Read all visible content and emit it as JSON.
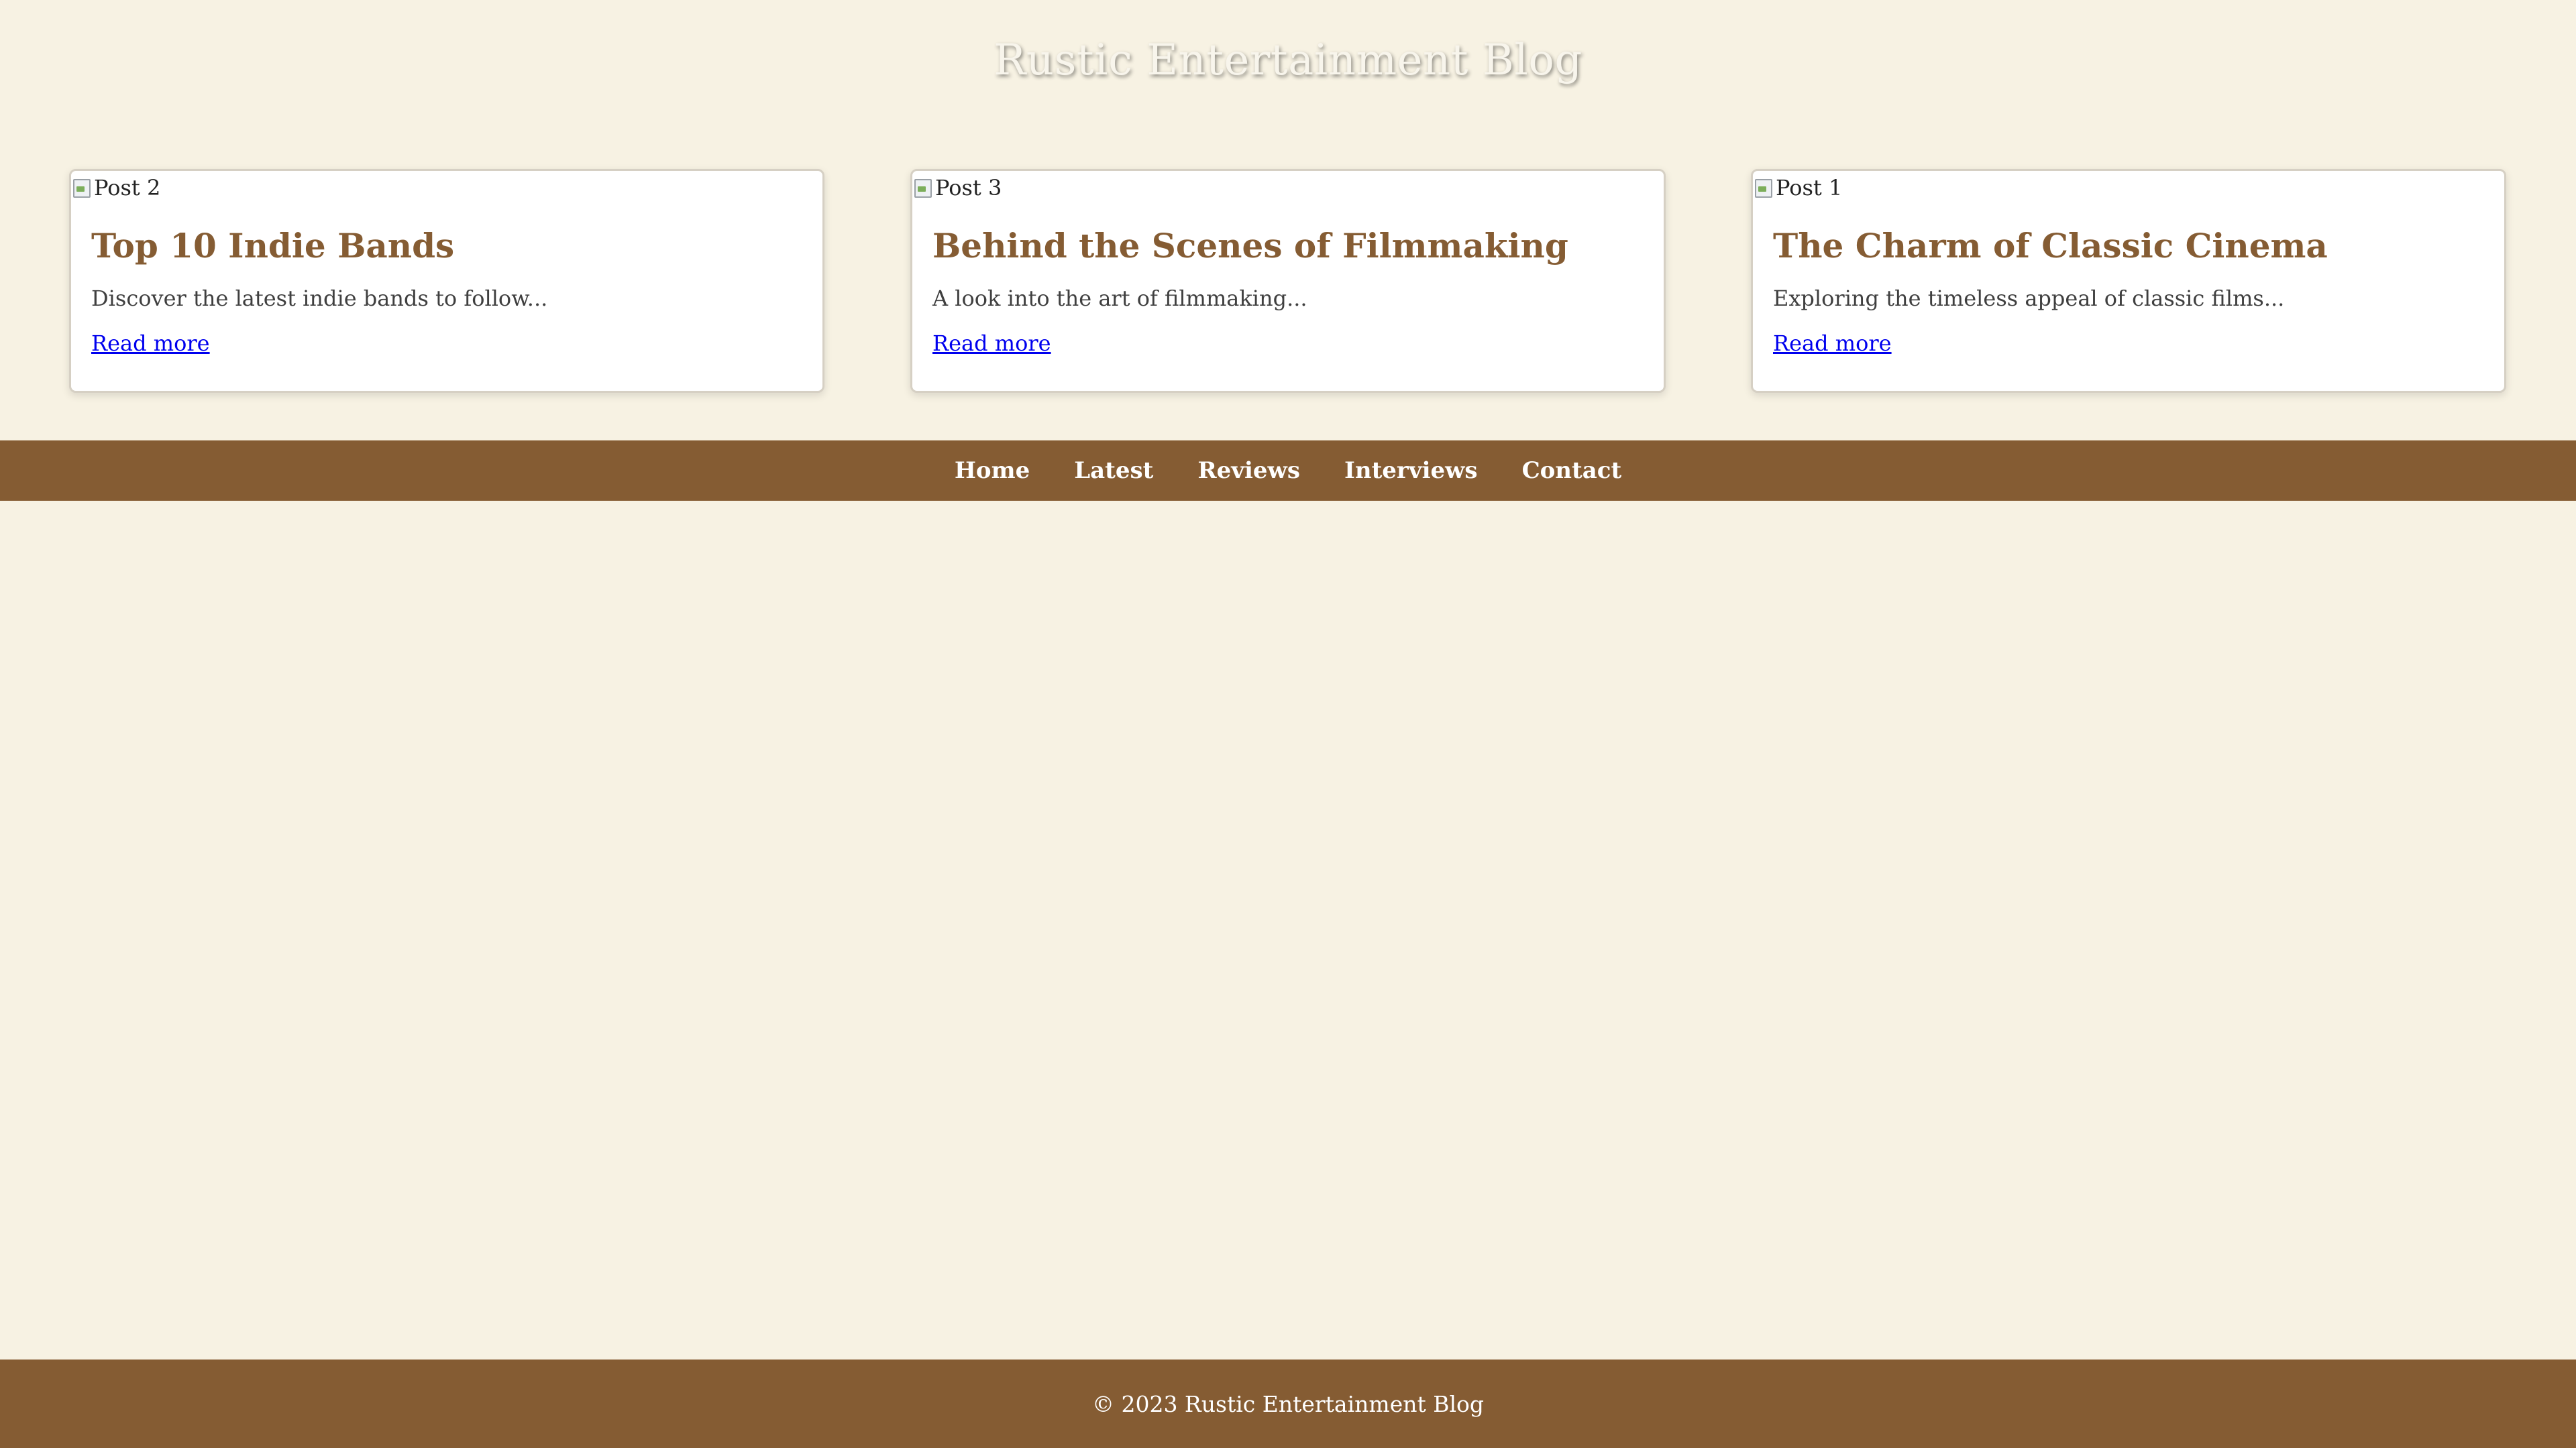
{
  "header": {
    "title": "Rustic Entertainment Blog"
  },
  "posts": [
    {
      "image_alt": "Post 2",
      "title": "Top 10 Indie Bands",
      "excerpt": "Discover the latest indie bands to follow...",
      "link_label": "Read more"
    },
    {
      "image_alt": "Post 3",
      "title": "Behind the Scenes of Filmmaking",
      "excerpt": "A look into the art of filmmaking...",
      "link_label": "Read more"
    },
    {
      "image_alt": "Post 1",
      "title": "The Charm of Classic Cinema",
      "excerpt": "Exploring the timeless appeal of classic films...",
      "link_label": "Read more"
    }
  ],
  "nav": {
    "items": [
      {
        "label": "Home"
      },
      {
        "label": "Latest"
      },
      {
        "label": "Reviews"
      },
      {
        "label": "Interviews"
      },
      {
        "label": "Contact"
      }
    ]
  },
  "footer": {
    "text": "© 2023 Rustic Entertainment Blog"
  },
  "colors": {
    "background": "#f7f2e3",
    "brand_brown": "#855c33",
    "link": "#0000ee"
  },
  "icons": {
    "post_image": "broken-image-icon"
  }
}
